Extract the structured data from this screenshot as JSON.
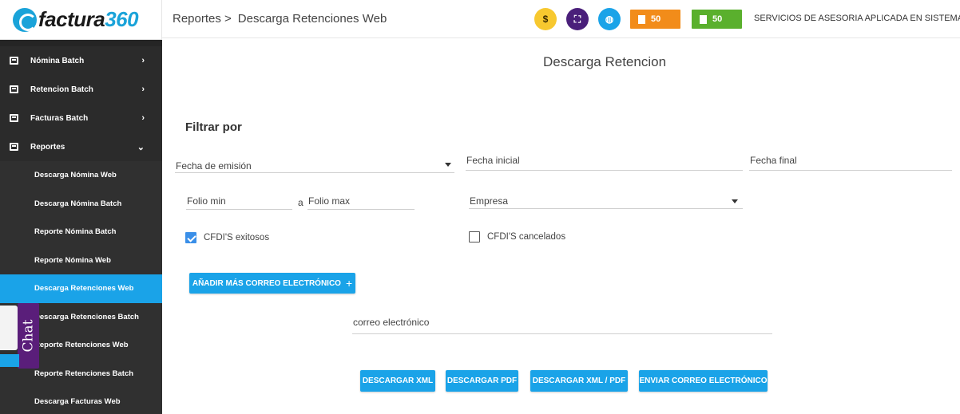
{
  "brand": {
    "name": "factura",
    "number": "360"
  },
  "sidebar": {
    "groups": [
      {
        "label": "Nómina Batch"
      },
      {
        "label": "Retencion Batch"
      },
      {
        "label": "Facturas Batch"
      },
      {
        "label": "Reportes"
      }
    ],
    "sub_items": [
      {
        "label": "Descarga Nómina Web"
      },
      {
        "label": "Descarga Nómina Batch"
      },
      {
        "label": "Reporte Nómina Batch"
      },
      {
        "label": "Reporte Nómina Web"
      },
      {
        "label": "Descarga Retenciones Web"
      },
      {
        "label": "Descarga Retenciones Batch"
      },
      {
        "label": "Reporte Retenciones Web"
      },
      {
        "label": "Reporte Retenciones Batch"
      },
      {
        "label": "Descarga Facturas Web"
      }
    ],
    "active_item": "Descarga Retenciones Web"
  },
  "chat": {
    "label": "Chat"
  },
  "header": {
    "breadcrumb": "Reportes >",
    "page": "Descarga Retenciones Web",
    "icons": [
      "dollar-icon",
      "expand-icon",
      "globe-icon"
    ],
    "dollar_glyph": "$",
    "counter_orange": "50",
    "counter_green": "50",
    "company": "SERVICIOS DE ASESORIA APLICADA EN SISTEMAS Z"
  },
  "main": {
    "title": "Descarga Retencion",
    "filter_title": "Filtrar por",
    "date_type": "Fecha de emisión",
    "start_date": "Fecha inicial",
    "end_date": "Fecha final",
    "folio_min": "Folio min",
    "folio_sep": "a",
    "folio_max": "Folio max",
    "company": "Empresa",
    "chk_success": {
      "label": "CFDI'S exitosos",
      "checked": true
    },
    "chk_cancelled": {
      "label": "CFDI'S cancelados",
      "checked": false
    },
    "add_email": "AÑADIR MÁS CORREO ELECTRÓNICO",
    "add_email_plus": "+",
    "email_label": "correo electrónico",
    "buttons": {
      "xml": "DESCARGAR XML",
      "pdf": "DESCARGAR PDF",
      "xml_pdf": "DESCARGAR XML / PDF",
      "send": "ENVIAR CORREO ELECTRÓNICO"
    }
  },
  "colors": {
    "accent": "#1aa3e8",
    "sidebar": "#2b2b2b",
    "purple": "#4a1f7a",
    "gold": "#f7c82f",
    "orange": "#f28c1a",
    "green": "#5ab02d"
  }
}
